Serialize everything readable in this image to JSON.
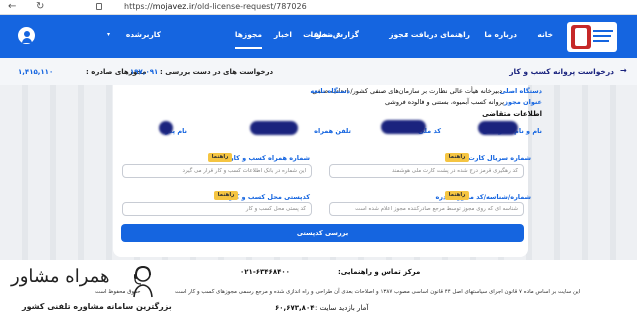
{
  "browser": {
    "url_prefix": "https://",
    "url_host": "mojavez.ir",
    "url_path": "/old-license-request/787026"
  },
  "nav": {
    "home": "خانه",
    "about": "درباره ما",
    "guide": "راهنمای دریافت مجوز",
    "report": "گزارش تخلف",
    "approvals": "مصوبات",
    "news": "اخبار",
    "licenses": "مجوزها",
    "user": "کاربر‌شده"
  },
  "stats": {
    "issued_label": "مجوزهای صادره :",
    "issued_value": "۱,۴۱۵,۱۱۰",
    "pending_label": "درخواست های در دست بررسی :",
    "pending_value": "۱۹۷,۰۹۱"
  },
  "breadcrumb": "درخواست پروانه کسب و کار",
  "form": {
    "main_authority_label": "دستگاه اصلی",
    "main_authority_value": "دبیرخانه هیأت عالی نظارت بر سازمان‌های صنفی کشور/ اتحادیه صنفی",
    "sub_authority_label": "دستگاه تابعه",
    "license_title_label": "عنوان مجوز",
    "license_title_value": "پروانه کسب آبمیوه، بستنی و فالوده فروشی",
    "applicant_heading": "اطلاعات متقاضی",
    "name_label": "نام و نام خانوادگی",
    "national_code_label": "کد ملی",
    "mobile_label": "تلفن همراه",
    "father_label": "نام پدر",
    "serial_label": "شماره سریال کارت ملی",
    "serial_placeholder": "کد رهگیری قرمز درج شده در پشت کارت ملی هوشمند",
    "business_mobile_label": "شماره همراه کسب و کار",
    "business_mobile_placeholder": "این شماره در بانک اطلاعات کسب و کار قرار می گیرد",
    "issued_license_label": "شماره/شناسه/کد مجوز صادره",
    "issued_license_placeholder": "شناسه ای که روی مجوز توسط مرجع صادرکننده مجوز اعلام شده است",
    "postal_label": "کدپستی محل کسب و کار",
    "postal_placeholder": "کد پستی محل کسب و کار",
    "guide_badge": "راهنما",
    "submit_label": "بررسی کدپستی"
  },
  "footer": {
    "contact_label": "مرکز تماس و راهنمایی:",
    "contact_number": "۰۲۱-۶۳۴۶۸۴۰۰",
    "legal_text": "این سایت بر اساس ماده ۷ قانون اجرای سیاستهای اصل ۴۴ قانون اساسی مصوب ۱۳۸۷ و اصلاحات بعدی آن طراحی و راه اندازی شده و مرجع رسمی مجوزهای کسب و کار است",
    "rights_text": "حقوق محفوظ است",
    "visits_label": "آمار بازدید سایت :",
    "visits_value": "۶۰,۶۷۳,۸۰۴"
  },
  "watermark": {
    "brand": "همراه مشاور",
    "tagline": "بزرگترین سامانه مشاوره تلفنی کشور"
  },
  "colors": {
    "primary": "#1565e0",
    "dark_navy": "#1a237e",
    "guide_yellow": "#f5c542"
  }
}
